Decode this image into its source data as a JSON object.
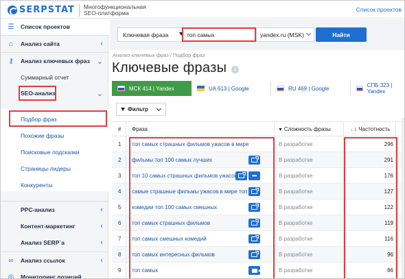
{
  "header": {
    "logo_text": "SERPSTAT",
    "tagline": "Многофункциональная SEO-платформа",
    "projects_link": "Список проектов"
  },
  "sidebar": {
    "projects_list": "Список проектов",
    "site_analysis": "Анализ сайта",
    "keyword_analysis": "Анализ ключевых фраз",
    "summary_report": "Суммарный отчет",
    "seo_analysis": "SEO-анализ",
    "sub_items": [
      "Подбор фраз",
      "Похожие фразы",
      "Поисковые подсказки",
      "Страницы-лидеры",
      "Конкуренты"
    ],
    "ppc": "PPC-анализ",
    "content_marketing": "Контент-маркетинг",
    "serp_analysis": "Анализ SERP`a",
    "link_analysis": "Анализ ссылок",
    "rank_tracking": "Мониторинг позиций"
  },
  "search": {
    "type_label": "Ключевая фраза",
    "query": "топ самых",
    "database": "yandex.ru (MSK)",
    "find_button": "Найти"
  },
  "breadcrumb": "Анализ ключевых фраз / Подбор фраз",
  "page_title": "Ключевые фразы",
  "db_tabs": [
    {
      "label": "МСК 414 | Yandex",
      "flag": "ru",
      "active": true
    },
    {
      "label": "UA 613 | Google",
      "flag": "ua",
      "active": false
    },
    {
      "label": "RU 469 | Google",
      "flag": "ru",
      "active": false
    },
    {
      "label": "СПБ 323 | Yandex",
      "flag": "ru",
      "active": false
    }
  ],
  "filter_label": "Фильтр",
  "table": {
    "headers": {
      "num": "#",
      "phrase": "Фраза",
      "difficulty": "Сложность фразы",
      "volume": "Частотность"
    },
    "rows": [
      {
        "num": "1",
        "phrase": "топ самых страшных фильмов ужасов в мире",
        "status": "В разработке",
        "volume": "296",
        "actions": []
      },
      {
        "num": "2",
        "phrase": "фильмы топ 100 самых лучших",
        "status": "В разработке",
        "volume": "291",
        "actions": [
          "link-icon"
        ]
      },
      {
        "num": "3",
        "phrase": "топ 10 самых страшных фильмов ужасов",
        "status": "В разработке",
        "volume": "176",
        "actions": [
          "link-icon",
          "more-icon"
        ]
      },
      {
        "num": "4",
        "phrase": "самые страшные фильмы ужасов в мире топ",
        "status": "В разработке",
        "volume": "127",
        "actions": [
          "link-icon"
        ]
      },
      {
        "num": "5",
        "phrase": "комедии топ 100 самых смешных",
        "status": "В разработке",
        "volume": "122",
        "actions": [
          "link-icon"
        ]
      },
      {
        "num": "6",
        "phrase": "топ самых страшных фильмов",
        "status": "В разработке",
        "volume": "119",
        "actions": [
          "link-icon"
        ]
      },
      {
        "num": "7",
        "phrase": "топ самых смешных комедий",
        "status": "В разработке",
        "volume": "116",
        "actions": [
          "link-icon"
        ]
      },
      {
        "num": "8",
        "phrase": "топ самых интересных фильмов",
        "status": "В разработке",
        "volume": "96",
        "actions": [
          "link-icon"
        ]
      },
      {
        "num": "9",
        "phrase": "топ самых",
        "status": "В разработке",
        "volume": "86",
        "actions": [
          "video-icon"
        ]
      }
    ]
  },
  "colors": {
    "accent": "#1f6fd1",
    "highlight": "#e23b3b",
    "active_tab": "#3f9b47"
  }
}
